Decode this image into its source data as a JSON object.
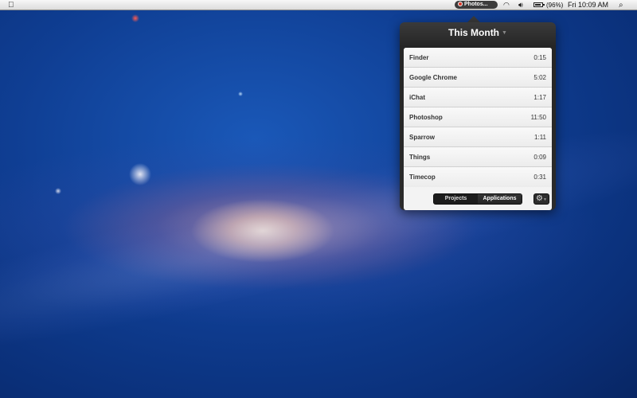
{
  "menubar": {
    "status_app": "Photos...",
    "battery": "(96%)",
    "clock": "Fri 10:09 AM",
    "icons": [
      "apple-icon",
      "wifi-icon",
      "volume-icon",
      "battery-icon",
      "search-icon"
    ]
  },
  "panel": {
    "title": "This Month",
    "rows": [
      {
        "name": "Finder",
        "time": "0:15"
      },
      {
        "name": "Google Chrome",
        "time": "5:02"
      },
      {
        "name": "iChat",
        "time": "1:17"
      },
      {
        "name": "Photoshop",
        "time": "11:50"
      },
      {
        "name": "Sparrow",
        "time": "1:11"
      },
      {
        "name": "Things",
        "time": "0:09"
      },
      {
        "name": "Timecop",
        "time": "0:31"
      }
    ],
    "segments": {
      "projects": "Projects",
      "applications": "Applications",
      "selected": "Applications"
    }
  },
  "colors": {
    "panel_bg": "#2b2b2b",
    "list_bg": "#f3f3f3",
    "record_red": "#d83a2a"
  }
}
